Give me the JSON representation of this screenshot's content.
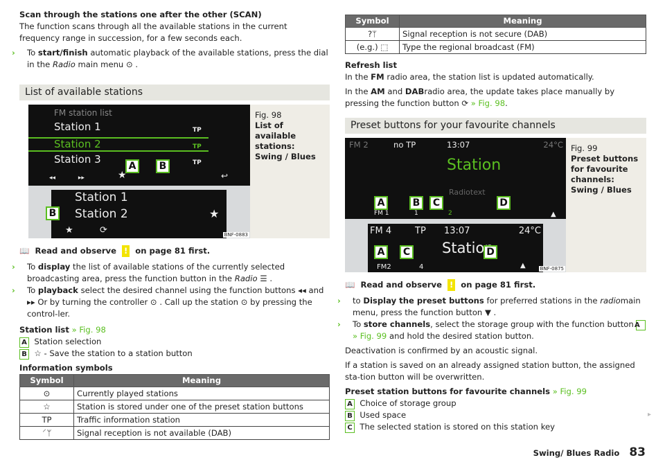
{
  "left": {
    "scan_title": "Scan through the stations one after the other (SCAN)",
    "scan_text": "The function scans through all the available stations in the current frequency range in succession, for a few seconds each.",
    "scan_bullet": {
      "pre": "To ",
      "bold": "start/finish",
      "mid": " automatic playback of the available stations, press the dial in the ",
      "ital": "Radio",
      "post": " main menu ⊙ ."
    },
    "section": "List of available stations",
    "fig": {
      "caption_num": "Fig. 98",
      "caption": "List of available stations: Swing / Blues",
      "header": "FM station list",
      "stations": [
        "Station 1",
        "Station 2",
        "Station 3"
      ],
      "tp": "TP",
      "lower_stations": [
        "Station 1",
        "Station 2"
      ],
      "code": "BNF-0883",
      "labels": [
        "A",
        "B"
      ]
    },
    "note": {
      "pre": "Read and observe",
      "warn": "!",
      "post": "on page 81 first."
    },
    "bullets": [
      {
        "pre": "To ",
        "bold": "display",
        "mid": " the list of available stations of the currently selected broadcasting area, press the function button in the ",
        "ital": "Radio",
        "post": " ☰ ."
      },
      {
        "pre": "To ",
        "bold": "playback",
        "mid": " select the desired channel using the function buttons ◂◂ and ▸▸ Or by turning the controller ⊙ . Call up the station ⊙ by pressing the control-ler.",
        "ital": "",
        "post": ""
      }
    ],
    "station_list": {
      "title": "Station list",
      "ref": "» Fig. 98",
      "items": [
        {
          "key": "A",
          "text": "Station selection"
        },
        {
          "key": "B",
          "text": "☆ - Save the station to a station button"
        }
      ]
    },
    "info_title": "Information symbols",
    "table": {
      "headers": [
        "Symbol",
        "Meaning"
      ],
      "rows": [
        [
          "⊙",
          "Currently played stations"
        ],
        [
          "☆",
          "Station is stored under one of the preset station buttons"
        ],
        [
          "TP",
          "Traffic information station"
        ],
        [
          "⸍ᛘ",
          "Signal reception is not available (DAB)"
        ]
      ]
    }
  },
  "right": {
    "table": {
      "headers": [
        "Symbol",
        "Meaning"
      ],
      "rows": [
        [
          "?ᛘ",
          "Signal reception is not secure (DAB)"
        ],
        [
          "(e.g.) ⬚",
          "Type the regional broadcast (FM)"
        ]
      ]
    },
    "refresh_title": "Refresh list",
    "refresh_1": {
      "pre": "In the ",
      "bold": "FM",
      "post": " radio area, the station list is updated automatically."
    },
    "refresh_2": {
      "pre": "In the ",
      "b1": "AM",
      "mid": " and ",
      "b2": "DAB",
      "post": "radio area, the update takes place manually by pressing the function button ⟳ ",
      "ref": "» Fig. 98",
      "end": "."
    },
    "section": "Preset buttons for your favourite channels",
    "fig": {
      "caption_num": "Fig. 99",
      "caption": "Preset buttons for favourite channels: Swing / Blues",
      "top": {
        "band": "FM 2",
        "tp": "no TP",
        "time": "13:07",
        "temp": "24°C",
        "station": "Station",
        "radiotext": "Radiotext",
        "group": "FM 1",
        "p1": "1",
        "p2": "2"
      },
      "bottom": {
        "band": "FM 4",
        "tp": "TP",
        "time": "13:07",
        "temp": "24°C",
        "station": "Station",
        "group": "FM2",
        "p": "4"
      },
      "code": "BNF-0875",
      "labels": [
        "A",
        "B",
        "C",
        "D"
      ]
    },
    "note": {
      "pre": "Read and observe",
      "warn": "!",
      "post": "on page 81 first."
    },
    "bullet1": {
      "pre": "to ",
      "bold": "Display the preset buttons",
      "mid": " for preferred stations in the ",
      "ital": "radio",
      "post": "main menu, press the function button ▼ ."
    },
    "bullet2": {
      "pre": "To ",
      "bold": "store channels",
      "mid": ", select the storage group with the function button ",
      "key": "A",
      "ref": "» Fig. 99",
      "post": " and hold the desired station button."
    },
    "deactivation": "Deactivation is confirmed by an acoustic signal.",
    "overwrite": "If a station is saved on an already assigned station button, the assigned sta-tion button will be overwritten.",
    "preset_title": "Preset station buttons for favourite channels",
    "preset_ref": "» Fig. 99",
    "items": [
      {
        "key": "A",
        "text": "Choice of storage group"
      },
      {
        "key": "B",
        "text": "Used space"
      },
      {
        "key": "C",
        "text": "The selected station is stored on this station key"
      }
    ],
    "continue": "▸"
  },
  "footer": {
    "chapter": "Swing/ Blues Radio",
    "page": "83"
  },
  "colors": {
    "accent": "#5bbf21",
    "warning": "#f3e400",
    "section_bg": "#e6e6e0"
  }
}
